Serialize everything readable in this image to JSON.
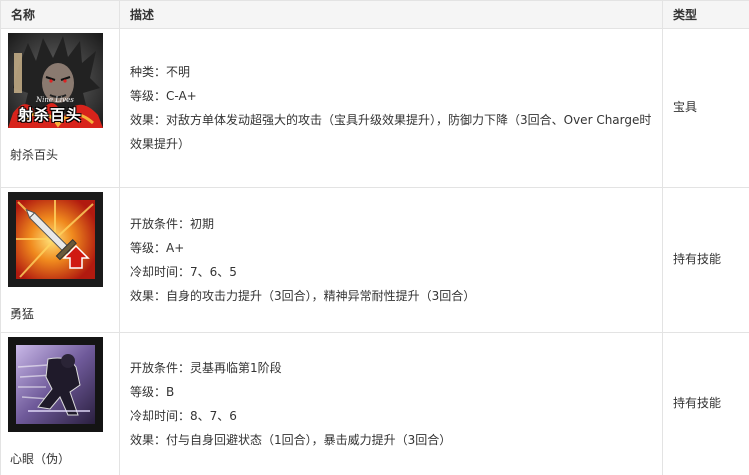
{
  "header": {
    "col_name": "名称",
    "col_desc": "描述",
    "col_type": "类型"
  },
  "rows": [
    {
      "name": "射杀百头",
      "icon": "nine-lives-portrait-icon",
      "icon_text_top": "Nine Lives",
      "icon_text_main": "射杀百头",
      "lines": [
        "种类：不明",
        "等级：C-A+",
        "效果：对敌方单体发动超强大的攻击（宝具升级效果提升），防御力下降（3回合、Over Charge时",
        "效果提升）"
      ],
      "type": "宝具"
    },
    {
      "name": "勇猛",
      "icon": "sword-attack-up-icon",
      "lines": [
        "开放条件：初期",
        "等级：A+",
        "冷却时间：7、6、5",
        "效果：自身的攻击力提升（3回合），精神异常耐性提升（3回合）"
      ],
      "type": "持有技能"
    },
    {
      "name": "心眼（伪）",
      "icon": "evasion-figure-icon",
      "lines": [
        "开放条件：灵基再临第1阶段",
        "等级：B",
        "冷却时间：8、7、6",
        "效果：付与自身回避状态（1回合），暴击威力提升（3回合）"
      ],
      "type": "持有技能"
    }
  ]
}
